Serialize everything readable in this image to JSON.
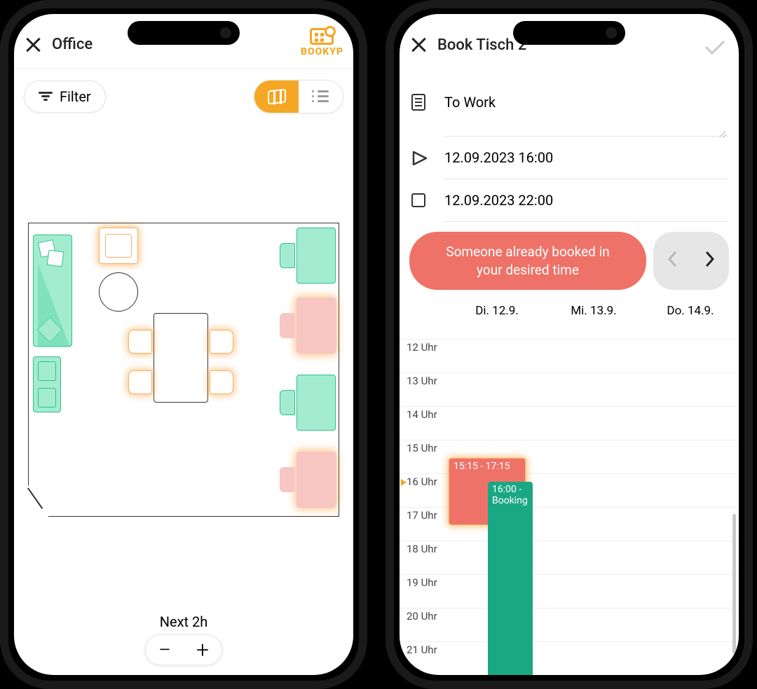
{
  "left": {
    "header_title": "Office",
    "brand": "BOOKYP",
    "filter_label": "Filter",
    "range_label": "Next 2h",
    "zoom_minus": "−",
    "zoom_plus": "+"
  },
  "right": {
    "header_title": "Book Tisch 2",
    "note_value": "To Work",
    "start_value": "12.09.2023 16:00",
    "end_value": "12.09.2023 22:00",
    "warning_line1": "Someone already booked in",
    "warning_line2": "your desired time",
    "days": [
      "Di. 12.9.",
      "Mi. 13.9.",
      "Do. 14.9."
    ],
    "hours": [
      "12 Uhr",
      "13 Uhr",
      "14 Uhr",
      "15 Uhr",
      "16 Uhr",
      "17 Uhr",
      "18 Uhr",
      "19 Uhr",
      "20 Uhr",
      "21 Uhr"
    ],
    "booking_conflict_label": "15:15 - 17:15",
    "booking_mine_label": "16:00 - Booking"
  },
  "colors": {
    "accent": "#F5A623",
    "danger": "#EE7268",
    "ok": "#1aa784"
  }
}
